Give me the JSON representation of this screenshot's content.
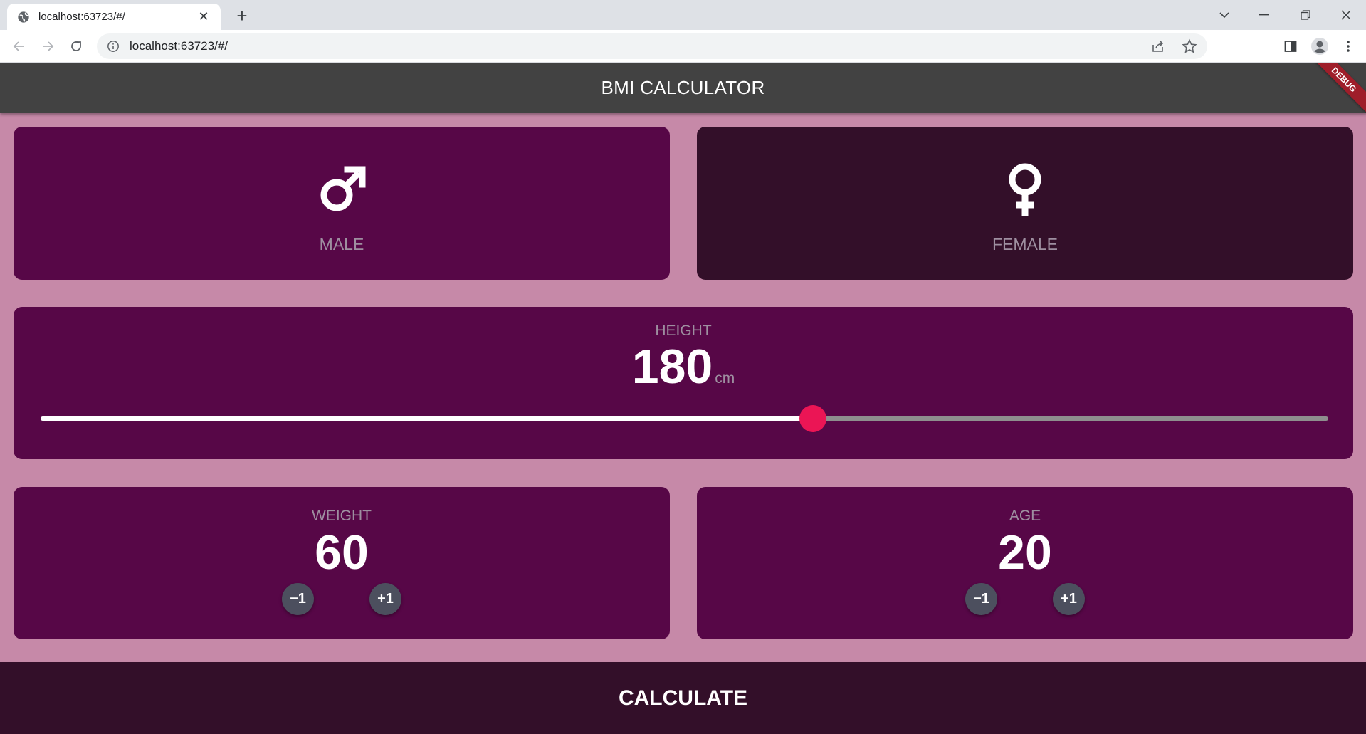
{
  "browser": {
    "tab_title": "localhost:63723/#/",
    "address": "localhost:63723/#/"
  },
  "app": {
    "title": "BMI CALCULATOR",
    "debug_banner": "DEBUG"
  },
  "gender": {
    "male": {
      "label": "MALE",
      "icon": "male-icon",
      "selected": true
    },
    "female": {
      "label": "FEMALE",
      "icon": "female-icon",
      "selected": false
    }
  },
  "height": {
    "label": "HEIGHT",
    "value": "180",
    "unit": "cm",
    "slider_fraction": 0.6
  },
  "weight": {
    "label": "WEIGHT",
    "value": "60",
    "minus": "−1",
    "plus": "+1"
  },
  "age": {
    "label": "AGE",
    "value": "20",
    "minus": "−1",
    "plus": "+1"
  },
  "calculate": {
    "label": "CALCULATE"
  },
  "colors": {
    "background": "#c689a8",
    "active_card": "#570747",
    "inactive_card": "#330f29",
    "slider_thumb": "#eb1555",
    "appbar": "#424242"
  }
}
